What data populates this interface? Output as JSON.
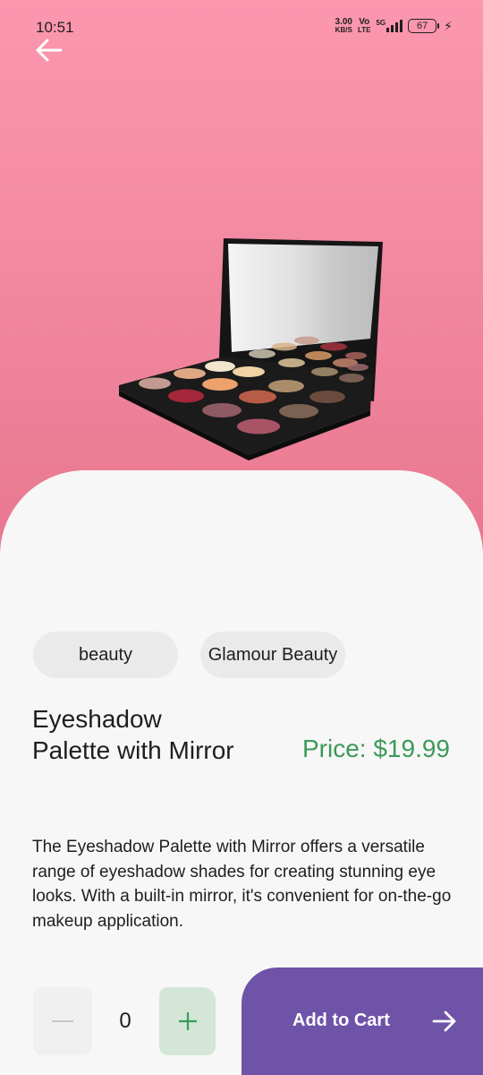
{
  "status_bar": {
    "time": "10:51",
    "speed_value": "3.00",
    "speed_unit": "KB/S",
    "network_top": "Vo",
    "network_bottom": "LTE",
    "network_type": "5G",
    "battery": "67"
  },
  "product": {
    "category": "beauty",
    "brand": "Glamour Beauty",
    "title": "Eyeshadow Palette with Mirror",
    "price": "Price: $19.99",
    "description": "The Eyeshadow Palette with Mirror offers a versatile range of eyeshadow shades for creating stunning eye looks. With a built-in mirror, it's convenient for on-the-go makeup application."
  },
  "cart": {
    "quantity": "0",
    "minus_label": "−",
    "plus_label": "+",
    "add_label": "Add to Cart"
  },
  "colors": {
    "hero_pink": "#f28aa2",
    "price_green": "#3c9a58",
    "button_purple": "#6e53a8",
    "plus_bg": "#d3e6d8"
  },
  "icons": {
    "back": "arrow-left-icon",
    "add_to_cart": "arrow-right-icon"
  }
}
